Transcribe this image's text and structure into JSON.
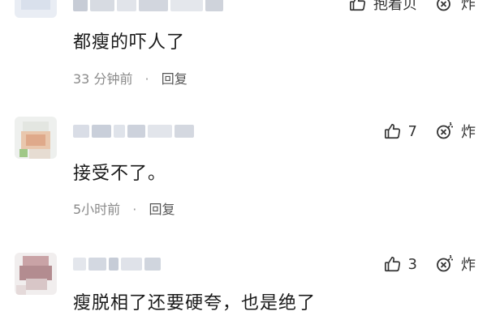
{
  "comments": [
    {
      "body": "都瘦的吓人了",
      "time": "33 分钟前",
      "dot": "·",
      "reply": "回复",
      "like_label": "抱着贝",
      "report_label": "炸"
    },
    {
      "body": "接受不了。",
      "time": "5小时前",
      "dot": "·",
      "reply": "回复",
      "like_count": "7",
      "report_label": "炸"
    },
    {
      "body": "瘦脱相了还要硬夸，也是绝了",
      "like_count": "3",
      "report_label": "炸"
    }
  ],
  "icons": {
    "like": "thumbs-up-icon",
    "report": "bomb-icon"
  },
  "colors": {
    "text": "#1a1a1a",
    "meta": "#8a8a8a",
    "icon": "#333333"
  }
}
